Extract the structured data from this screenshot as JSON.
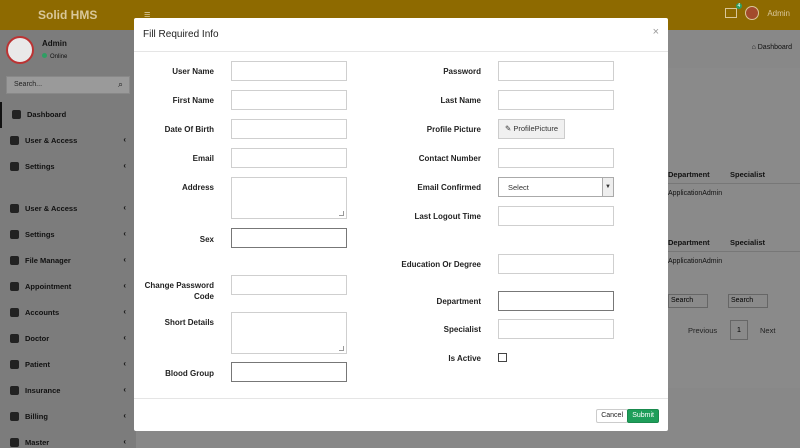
{
  "app": {
    "brand": "Solid HMS",
    "menu_toggle": "≡",
    "mail_badge": "4",
    "user_display": "Admin"
  },
  "sidebar": {
    "user_name": "Admin",
    "user_status": "Online",
    "search_placeholder": "Search...",
    "items": [
      {
        "label": "Dashboard",
        "icon": "dashboard-icon"
      },
      {
        "label": "User & Access",
        "icon": "user-icon"
      },
      {
        "label": "Settings",
        "icon": "gear-icon"
      },
      {
        "label": "User & Access",
        "icon": "user-icon"
      },
      {
        "label": "Settings",
        "icon": "gear-icon"
      },
      {
        "label": "File Manager",
        "icon": "folder-icon"
      },
      {
        "label": "Appointment",
        "icon": "calendar-icon"
      },
      {
        "label": "Accounts",
        "icon": "accounts-icon"
      },
      {
        "label": "Doctor",
        "icon": "doctor-icon"
      },
      {
        "label": "Patient",
        "icon": "patient-icon"
      },
      {
        "label": "Insurance",
        "icon": "insurance-icon"
      },
      {
        "label": "Billing",
        "icon": "billing-icon"
      },
      {
        "label": "Master",
        "icon": "master-icon"
      }
    ]
  },
  "background": {
    "breadcrumb": "Dashboard",
    "col_department": "Department",
    "col_specialist": "Specialist",
    "cell_dept": "ApplicationAdmin",
    "search_placeholder": "Search",
    "pager_prev": "Previous",
    "pager_page": "1",
    "pager_next": "Next"
  },
  "modal": {
    "title": "Fill Required Info",
    "close": "×",
    "labels": {
      "user_name": "User Name",
      "first_name": "First Name",
      "date_of_birth": "Date Of Birth",
      "email": "Email",
      "address": "Address",
      "sex": "Sex",
      "change_password_code": "Change Password Code",
      "short_details": "Short Details",
      "blood_group": "Blood Group",
      "password": "Password",
      "last_name": "Last Name",
      "profile_picture": "Profile Picture",
      "contact_number": "Contact Number",
      "email_confirmed": "Email Confirmed",
      "last_logout_time": "Last Logout Time",
      "education_or_degree": "Education Or Degree",
      "department": "Department",
      "specialist": "Specialist",
      "is_active": "Is Active"
    },
    "profile_picture_button": "ProfilePicture",
    "email_confirmed_value": "Select",
    "cancel": "Cancel",
    "submit": "Submit"
  },
  "colors": {
    "topbar": "#8e6a00",
    "submit": "#1e9e5a",
    "online": "#2f9e63"
  }
}
